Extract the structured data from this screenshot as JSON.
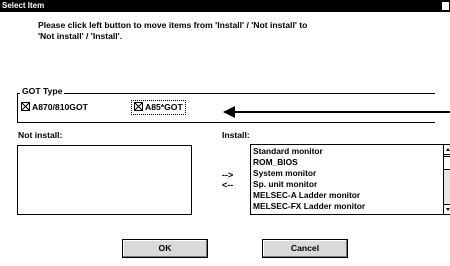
{
  "window": {
    "title": "Select Item"
  },
  "instruction": {
    "line1": "Please click left button to move items from 'Install' / 'Not install' to",
    "line2": "'Not install' / 'Install'."
  },
  "got_type": {
    "legend": "GOT Type",
    "options": [
      {
        "label": "A870/810GOT",
        "checked": true
      },
      {
        "label": "A85*GOT",
        "checked": true,
        "focused": true
      }
    ]
  },
  "not_install": {
    "label": "Not install:",
    "items": []
  },
  "install": {
    "label": "Install:",
    "items": [
      "Standard monitor",
      "ROM_BIOS",
      "System monitor",
      "Sp. unit monitor",
      "MELSEC-A Ladder monitor",
      "MELSEC-FX Ladder monitor"
    ]
  },
  "move_buttons": {
    "to_install": "-->",
    "to_not_install": "<--"
  },
  "buttons": {
    "ok": "OK",
    "cancel": "Cancel"
  }
}
